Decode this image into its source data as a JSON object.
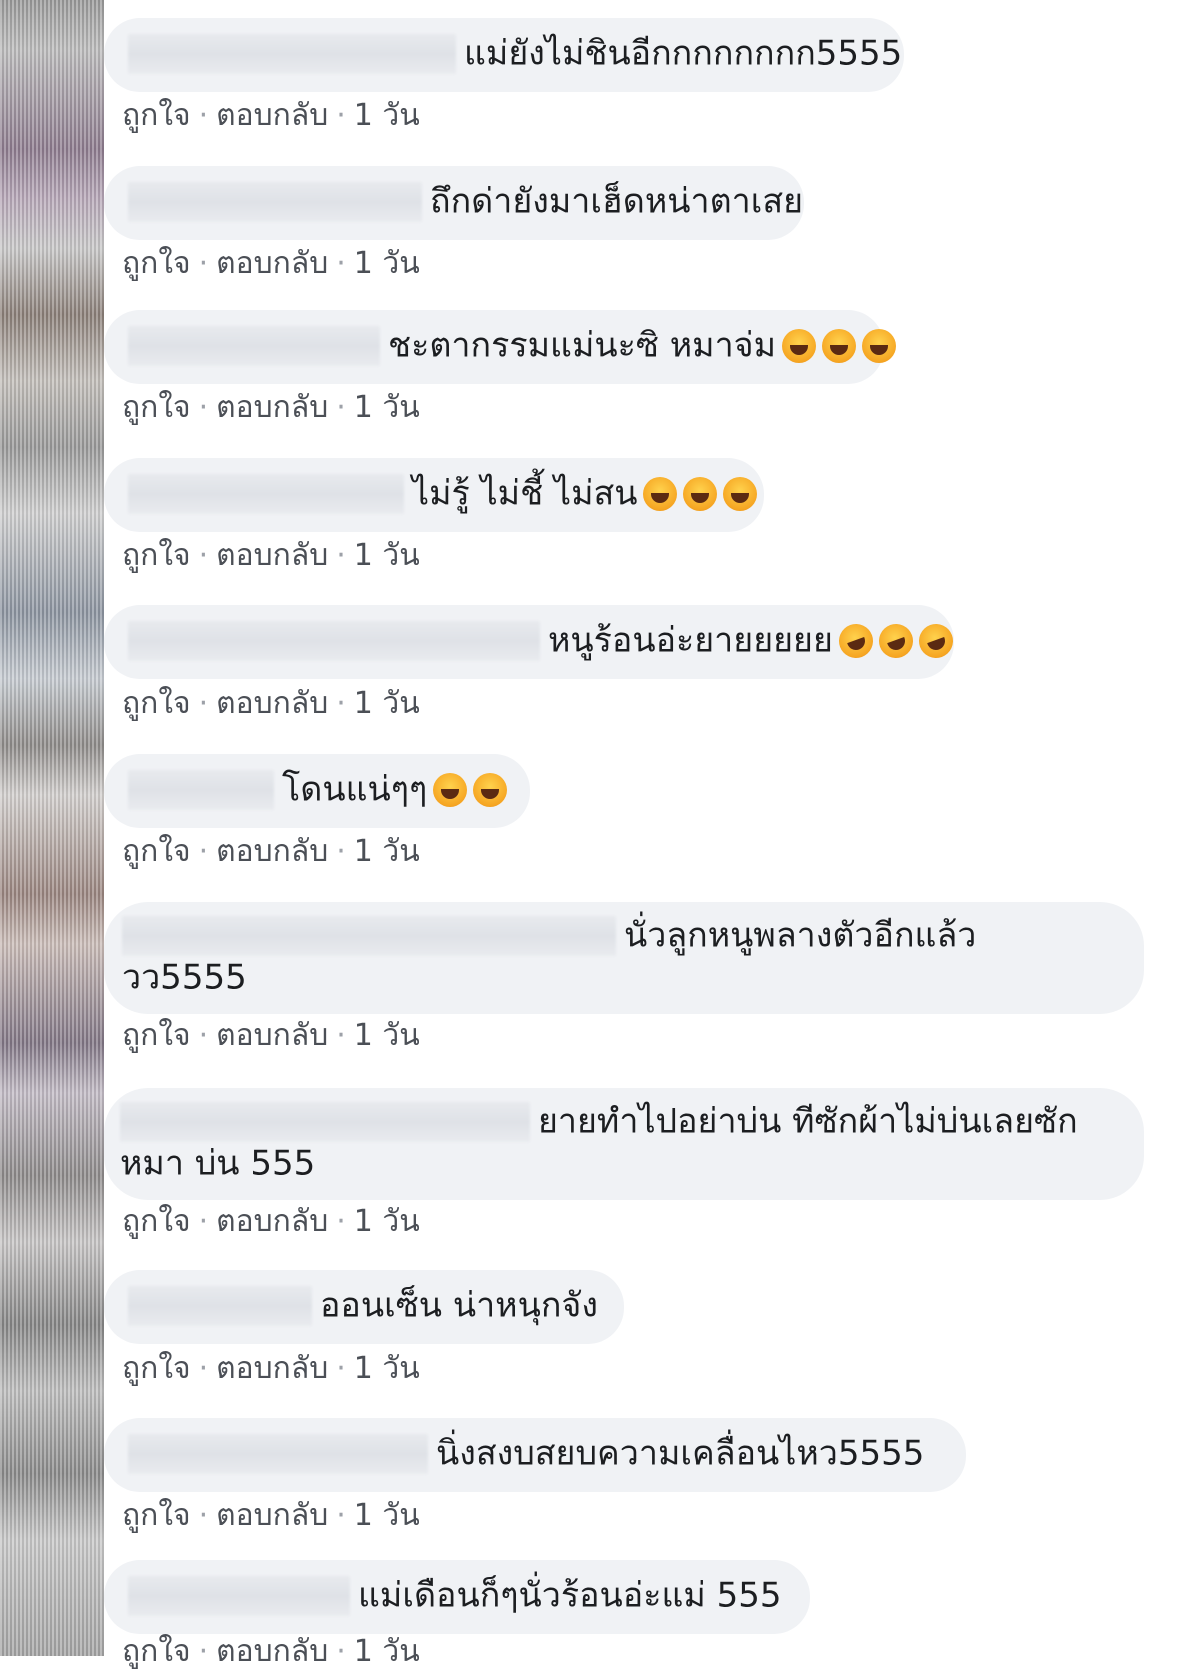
{
  "actions": {
    "like": "ถูกใจ",
    "reply": "ตอบกลับ",
    "separator": "·",
    "time": "1 วัน"
  },
  "comments": [
    {
      "text": "แม่ยังไม่ชินอีกกกกกกกก5555",
      "emoji": ""
    },
    {
      "text": "ถึกด่ายังมาเฮ็ดหน่าตาเสย",
      "emoji": ""
    },
    {
      "text": "ชะตากรรมแม่นะซิ หมาจ่ม",
      "emoji": "😂😂😂"
    },
    {
      "text": "ไม่รู้ ไม่ชี้ ไม่สน",
      "emoji": "😂😂😂"
    },
    {
      "text": "หนูร้อนอ่ะยายยยยย",
      "emoji": "🤣🤣🤣"
    },
    {
      "text": "โดนแน่ๆๆ",
      "emoji": "😂😂"
    },
    {
      "text": "นั่วลูกหนูพลางตัวอีกแล้ววว5555",
      "emoji": ""
    },
    {
      "text": "ยายทำไปอย่าบ่น ทีซักผ้าไม่บ่นเลยซักหมา บ่น 555",
      "emoji": ""
    },
    {
      "text": "ออนเซ็น น่าหนุกจัง",
      "emoji": ""
    },
    {
      "text": "นิ่งสงบสยบความเคลื่อนไหว5555",
      "emoji": ""
    },
    {
      "text": "แม่เดือนก็ๆนั่วร้อนอ่ะแม่ 555",
      "emoji": ""
    }
  ]
}
